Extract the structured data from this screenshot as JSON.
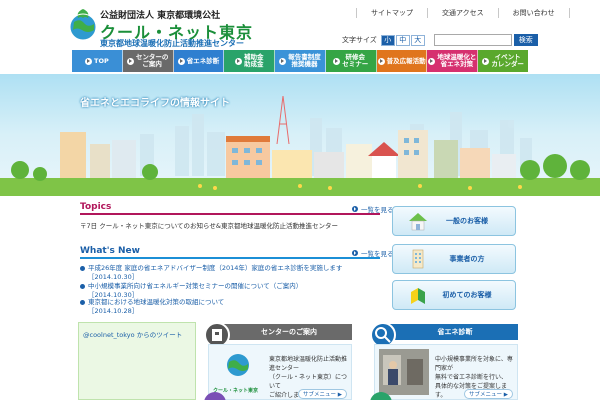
{
  "header": {
    "sub_title": "公益財団法人 東京都環境公社",
    "main_title": "クール・ネット東京",
    "org_name": "東京都地球温暖化防止活動推進センター",
    "links": [
      "サイトマップ",
      "交通アクセス",
      "お問い合わせ"
    ],
    "font_size_label": "文字サイズ",
    "font_sizes": [
      "小",
      "中",
      "大"
    ],
    "search_placeholder": "",
    "search_label": "検索"
  },
  "nav": [
    {
      "label": "TOP",
      "color": "#3a8fd6"
    },
    {
      "label": "センターの\nご案内",
      "color": "#6a6a6a"
    },
    {
      "label": "省エネ診断",
      "color": "#2f7fd0"
    },
    {
      "label": "補助金\n助成金",
      "color": "#2aa36a"
    },
    {
      "label": "報告書制度\n推奨機器",
      "color": "#3a93d8"
    },
    {
      "label": "研修会\nセミナー",
      "color": "#35a545"
    },
    {
      "label": "普及広報活動",
      "color": "#e0751d"
    },
    {
      "label": "地球温暖化と\n省エネ対策",
      "color": "#d6306f"
    },
    {
      "label": "イベント\nカレンダー",
      "color": "#5aa82d"
    }
  ],
  "hero": {
    "title": "省エネとエコライフの情報サイト"
  },
  "topics": {
    "heading": "Topics",
    "list_label": "一覧を見る",
    "text": "〒7日 クール・ネット東京についてのお知らせ&東京都地球温暖化防止活動推進センター"
  },
  "news": {
    "heading": "What's New",
    "list_label": "一覧を見る",
    "items": [
      {
        "title": "平成26年度 家庭の省エネアドバイザー制度（2014年）家庭の省エネ診断を実施します",
        "date": "［2014.10.30］"
      },
      {
        "title": "中小規模事業所向け省エネルギー対策セミナーの開催について（ご案内）",
        "date": "［2014.10.30］"
      },
      {
        "title": "東京都における地球温暖化対策の取組について",
        "date": "［2014.10.28］"
      }
    ]
  },
  "right_buttons": [
    {
      "label": "一般のお客様"
    },
    {
      "label": "事業者の方"
    },
    {
      "label": "初めてのお客様"
    }
  ],
  "twitter": {
    "text": "@coolnet_tokyo からのツイート"
  },
  "panels": [
    {
      "title": "センターのご案内",
      "lines": [
        "東京都地球温暖化防止活動推進センター",
        "（クール・ネット東京）について",
        "ご紹介します。"
      ],
      "btn": "サブメニュー ▶",
      "logo_caption": "クール・ネット東京"
    },
    {
      "title": "省エネ診断",
      "lines": [
        "中小規模事業所を対象に、専門家が",
        "無料で省エネ診断を行い、",
        "具体的な対策をご提案します。"
      ],
      "btn": "サブメニュー ▶"
    }
  ]
}
